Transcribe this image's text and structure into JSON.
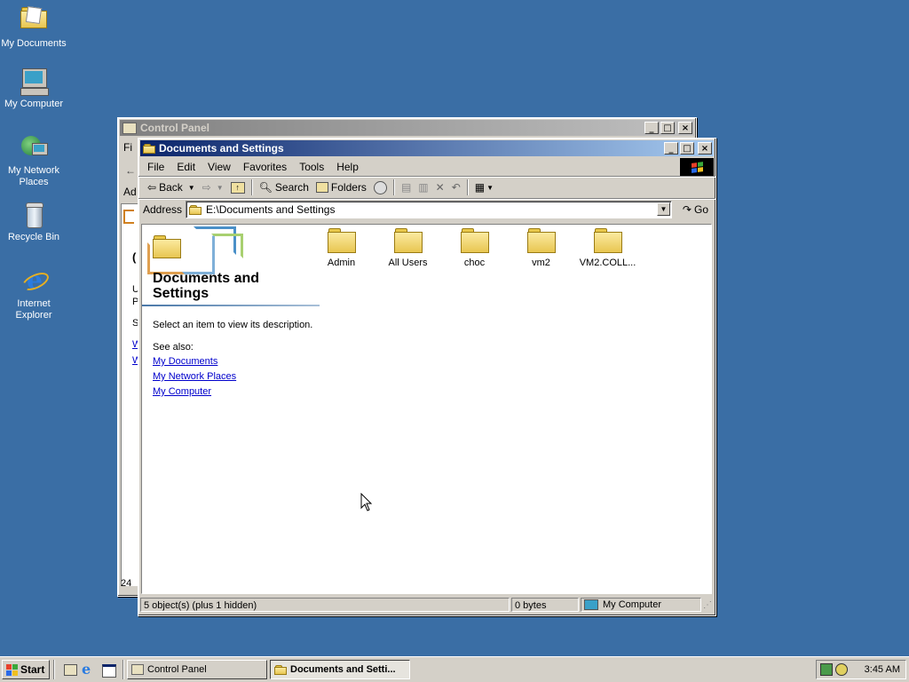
{
  "desktop": {
    "icons": [
      {
        "label": "My Documents"
      },
      {
        "label": "My Computer"
      },
      {
        "label": "My Network Places"
      },
      {
        "label": "Recycle Bin"
      },
      {
        "label": "Internet Explorer"
      }
    ]
  },
  "control_panel": {
    "title": "Control Panel",
    "partial_menu": "Fi",
    "partial_addr": "Ad",
    "partial_left": [
      "U",
      "P",
      "S",
      "W",
      "W"
    ],
    "partial_status": "24"
  },
  "explorer": {
    "title": "Documents and Settings",
    "menu": [
      "File",
      "Edit",
      "View",
      "Favorites",
      "Tools",
      "Help"
    ],
    "toolbar": {
      "back": "Back",
      "search": "Search",
      "folders": "Folders"
    },
    "address": {
      "label": "Address",
      "value": "E:\\Documents and Settings",
      "go": "Go"
    },
    "left_panel": {
      "heading": "Documents and Settings",
      "description": "Select an item to view its description.",
      "see_also": "See also:",
      "links": [
        "My Documents",
        "My Network Places",
        "My Computer"
      ]
    },
    "files": [
      {
        "name": "Admin"
      },
      {
        "name": "All Users"
      },
      {
        "name": "choc"
      },
      {
        "name": "vm2"
      },
      {
        "name": "VM2.COLL..."
      }
    ],
    "status": {
      "objects": "5 object(s) (plus 1 hidden)",
      "size": "0 bytes",
      "zone": "My Computer"
    }
  },
  "taskbar": {
    "start": "Start",
    "tasks": [
      {
        "label": "Control Panel"
      },
      {
        "label": "Documents and Setti..."
      }
    ],
    "clock": "3:45 AM"
  },
  "colors": {
    "desktop": "#3a6ea5",
    "title_active": "#0a246a",
    "link": "#0000cc"
  }
}
